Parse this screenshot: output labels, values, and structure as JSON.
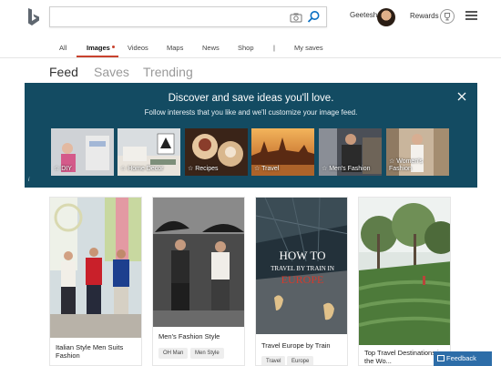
{
  "header": {
    "search_value": "",
    "user_name": "Geetesh",
    "rewards_label": "Rewards"
  },
  "nav": {
    "items": [
      "All",
      "Images",
      "Videos",
      "Maps",
      "News",
      "Shop",
      "|",
      "My saves"
    ],
    "active": "Images"
  },
  "subtabs": {
    "feed": "Feed",
    "saves": "Saves",
    "trending": "Trending"
  },
  "banner": {
    "title": "Discover and save ideas you'll love.",
    "subtitle": "Follow interests that you like and we'll customize your image feed.",
    "categories": [
      {
        "label": "☆ DIY"
      },
      {
        "label": "☆ Home Decor"
      },
      {
        "label": "☆ Recipes"
      },
      {
        "label": "☆ Travel"
      },
      {
        "label": "☆ Men's Fashion"
      },
      {
        "label": "☆ Women's\nFashion"
      }
    ]
  },
  "cards": [
    {
      "title": "Italian Style Men Suits Fashion",
      "tags": []
    },
    {
      "title": "Men's Fashion Style",
      "tags": [
        "OH Man",
        "Men Style"
      ]
    },
    {
      "title": "Travel Europe by Train",
      "tags": [
        "Travel",
        "Europe"
      ],
      "overlay_line1": "HOW TO",
      "overlay_line2": "TRAVEL BY TRAIN IN",
      "overlay_line3": "EUROPE"
    },
    {
      "title": "Top Travel Destinations in the Wo...",
      "tags": []
    }
  ],
  "feedback_label": "Feedback",
  "colors": {
    "accent": "#c8422e",
    "banner_bg": "#134b62",
    "search_blue": "#0a6fc2"
  }
}
